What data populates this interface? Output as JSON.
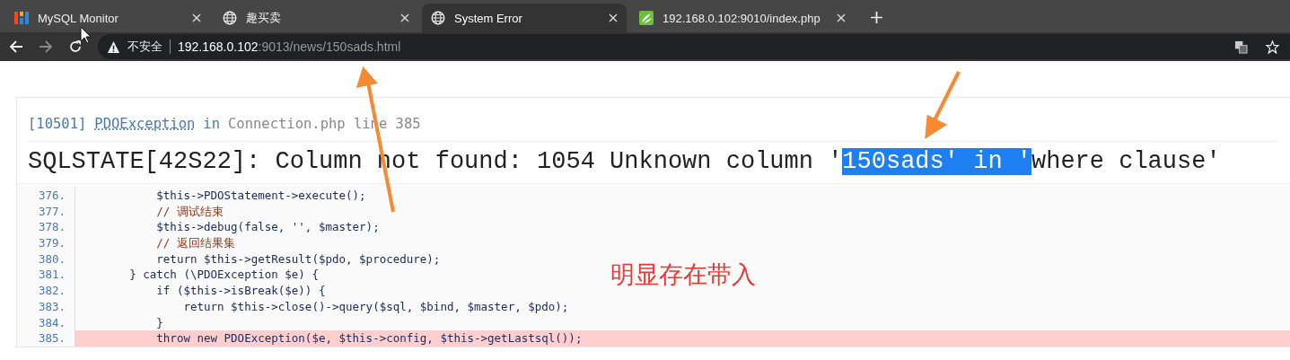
{
  "tabs": [
    {
      "title": "MySQL Monitor",
      "kind": "bars",
      "selected": false
    },
    {
      "title": "趣买卖",
      "kind": "globe",
      "selected": false
    },
    {
      "title": "System Error",
      "kind": "globe",
      "selected": true
    },
    {
      "title": "192.168.0.102:9010/index.php",
      "kind": "leaf",
      "selected": false
    }
  ],
  "address": {
    "security": "不安全",
    "host": "192.168.0.102",
    "path": ":9013/news/150sads.html"
  },
  "error": {
    "code": "[10501]",
    "exception": "PDOException",
    "in": "in",
    "location": "Connection.php line 385",
    "message": [
      {
        "text": "SQLSTATE[42S22]: Column not found: 1054 Unknown column '",
        "selected": false
      },
      {
        "text": "150sads' in '",
        "selected": true
      },
      {
        "text": "where clause'",
        "selected": false
      }
    ]
  },
  "code_lines": [
    {
      "number": "376.",
      "code": "            $this->PDOStatement->execute();",
      "kind": "code",
      "highlighted": false
    },
    {
      "number": "377.",
      "code": "            // 调试结束",
      "kind": "comment",
      "highlighted": false
    },
    {
      "number": "378.",
      "code": "            $this->debug(false, '', $master);",
      "kind": "code",
      "highlighted": false
    },
    {
      "number": "379.",
      "code": "            // 返回结果集",
      "kind": "comment",
      "highlighted": false
    },
    {
      "number": "380.",
      "code": "            return $this->getResult($pdo, $procedure);",
      "kind": "code",
      "highlighted": false
    },
    {
      "number": "381.",
      "code": "        } catch (\\PDOException $e) {",
      "kind": "code",
      "highlighted": false
    },
    {
      "number": "382.",
      "code": "            if ($this->isBreak($e)) {",
      "kind": "code",
      "highlighted": false
    },
    {
      "number": "383.",
      "code": "                return $this->close()->query($sql, $bind, $master, $pdo);",
      "kind": "code",
      "highlighted": false
    },
    {
      "number": "384.",
      "code": "            }",
      "kind": "code",
      "highlighted": false
    },
    {
      "number": "385.",
      "code": "            throw new PDOException($e, $this->config, $this->getLastsql());",
      "kind": "code",
      "highlighted": true
    }
  ],
  "annotation": "明显存在带入"
}
